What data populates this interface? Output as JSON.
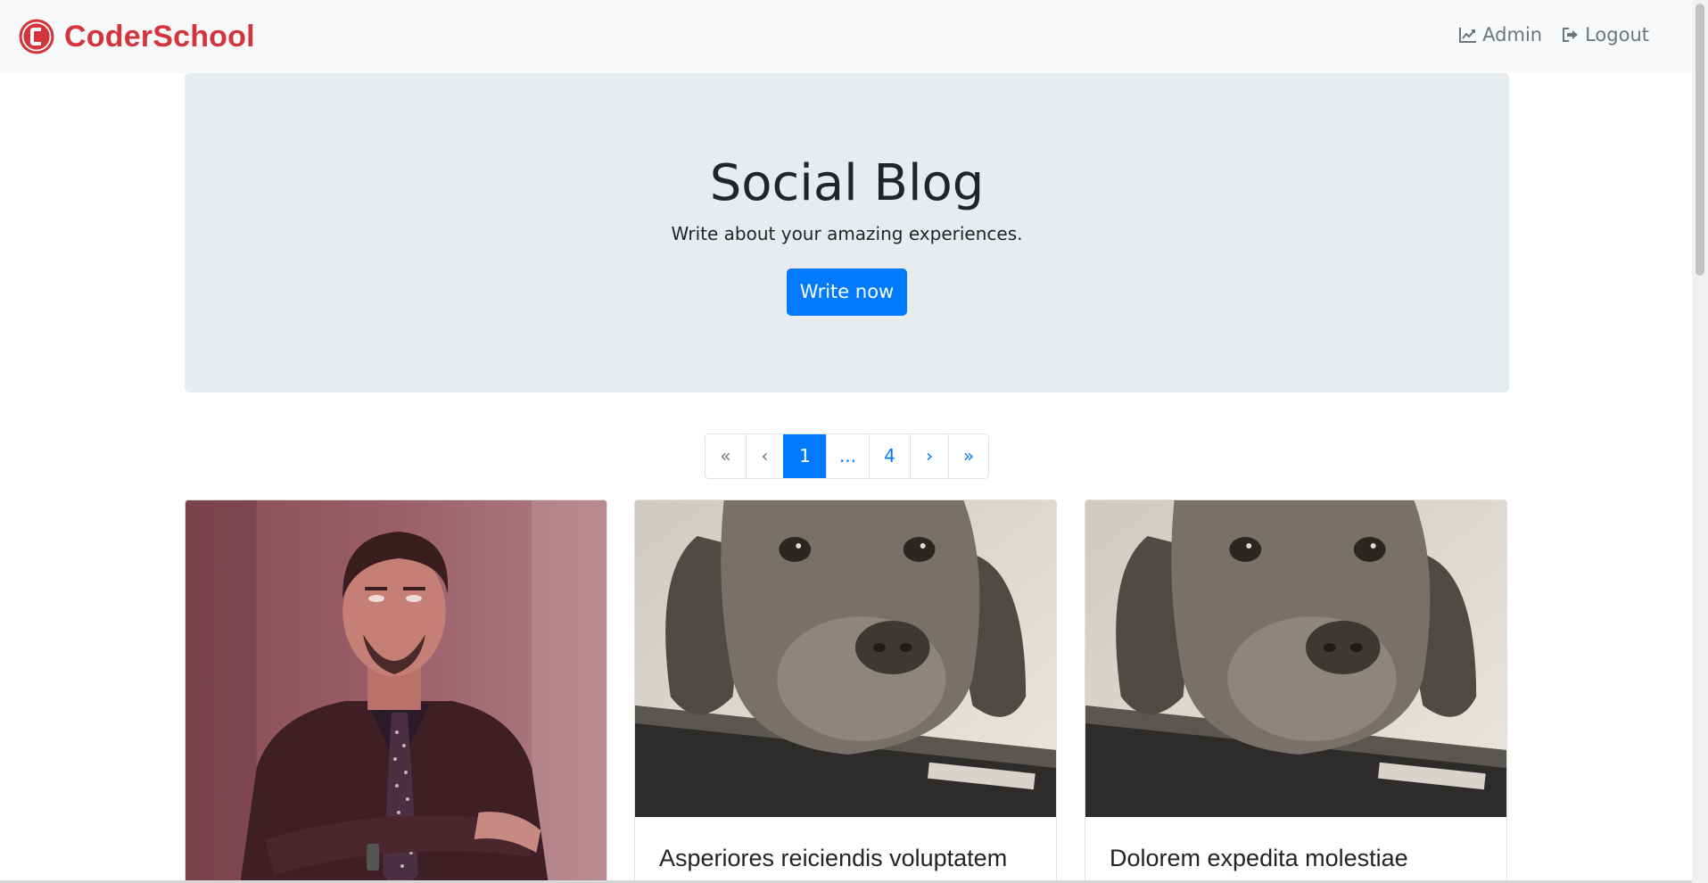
{
  "navbar": {
    "brand": "CoderSchool",
    "admin_label": "Admin",
    "logout_label": "Logout"
  },
  "jumbotron": {
    "title": "Social Blog",
    "subtitle": "Write about your amazing experiences.",
    "button_label": "Write now"
  },
  "pagination": {
    "first": "«",
    "prev": "‹",
    "current": "1",
    "ellipsis": "...",
    "last_page": "4",
    "next": "›",
    "last": "»"
  },
  "cards": [
    {
      "title": "",
      "image": "man-crossed-arms-photo"
    },
    {
      "title": "Asperiores reiciendis voluptatem",
      "image": "dog-on-box-photo"
    },
    {
      "title": "Dolorem expedita molestiae",
      "image": "dog-on-box-photo"
    }
  ],
  "colors": {
    "brand": "#d4353c",
    "primary": "#007bff",
    "navbar_bg": "#f8f9fa",
    "jumbotron_bg": "#e9ecef"
  },
  "icons": {
    "admin": "chart-line-icon",
    "logout": "sign-out-icon"
  }
}
